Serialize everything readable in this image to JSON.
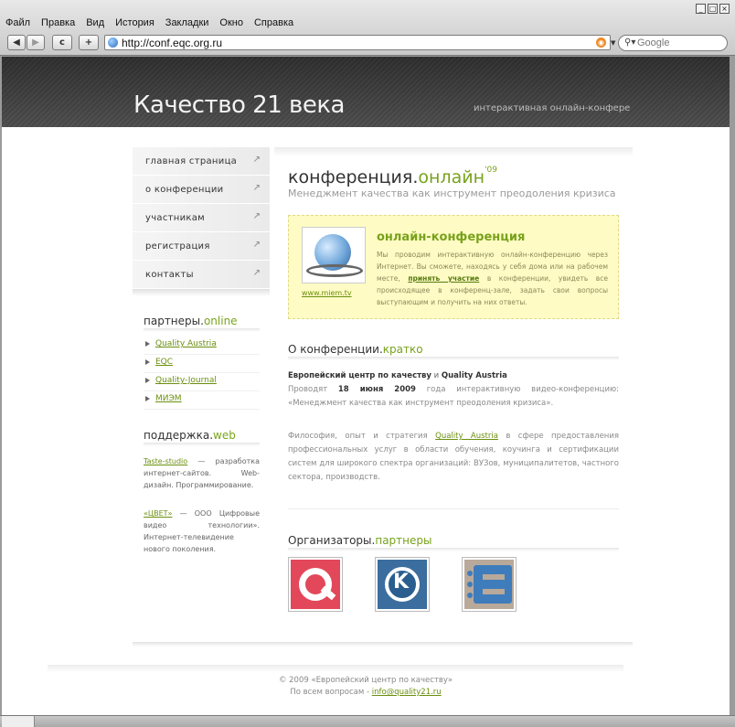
{
  "browser": {
    "menu": [
      "Файл",
      "Правка",
      "Вид",
      "История",
      "Закладки",
      "Окно",
      "Справка"
    ],
    "nav": {
      "back": "◀",
      "forward": "▶",
      "reload": "c",
      "add": "+"
    },
    "url": "http://conf.eqc.org.ru",
    "search_placeholder": "Google"
  },
  "header": {
    "title": "Качество 21 века",
    "tagline": "интерактивная онлайн-конфере"
  },
  "sidenav": [
    {
      "label": "главная страница"
    },
    {
      "label": "о конференции"
    },
    {
      "label": "участникам"
    },
    {
      "label": "регистрация"
    },
    {
      "label": "контакты"
    }
  ],
  "partners": {
    "heading_main": "партнеры.",
    "heading_accent": "online",
    "links": [
      "Quality Austria",
      "EQC",
      "Quality-Journal",
      "МИЭМ"
    ]
  },
  "support": {
    "heading_main": "поддержка.",
    "heading_accent": "web",
    "item1_link": "Taste-studio",
    "item1_text": " — разработка интернет-сайтов. Web-дизайн. Программирование.",
    "item2_link": "«ЦВЕТ»",
    "item2_text": " — ООО Цифровые видео технологии». Интернет-телевидение нового поколения."
  },
  "main": {
    "title_main": "конференция.",
    "title_accent": "онлайн",
    "title_sup": "'09",
    "subtitle": "Менеджмент качества как инструмент преодоления кризиса",
    "promo": {
      "heading": "онлайн-конференция",
      "image_link": "www.miem.tv",
      "text_before": "Мы проводим интерактивную онлайн-конференцию через Интернет. Вы сможете, находясь у себя дома или на рабочем месте, ",
      "link": "принять участие",
      "text_after": " в конференции, увидеть все происходящее в конференц-зале, задать свои вопросы выступающим и получить на них ответы."
    },
    "about": {
      "heading_main": "О конференции.",
      "heading_accent": "кратко",
      "org1": "Европейский центр по качеству",
      "and": " и ",
      "org2": "Quality Austria",
      "p1_a": "Проводят ",
      "p1_date": "18 июня 2009",
      "p1_b": " года интерактивную видео-конференцию: «Менеджмент качества как инструмент преодоления кризиса».",
      "p2_a": "Философия, опыт и стратегия ",
      "p2_link": "Quality Austria",
      "p2_b": " в сфере предоставления профессиональных услуг в области обучения, коучинга и сертификации систем для широкого спектра организаций: ВУЗов, муниципалитетов, частного сектора, производств."
    },
    "organizers": {
      "heading_main": "Организаторы.",
      "heading_accent": "партнеры"
    }
  },
  "footer": {
    "line1": "© 2009 «Европейский центр по качеству»",
    "line2": "По всем вопросам - ",
    "email": "info@quality21.ru"
  },
  "colors": {
    "accent": "#78a21c",
    "header_bg": "#3e3e3e",
    "promo_bg": "#fffbc4"
  }
}
